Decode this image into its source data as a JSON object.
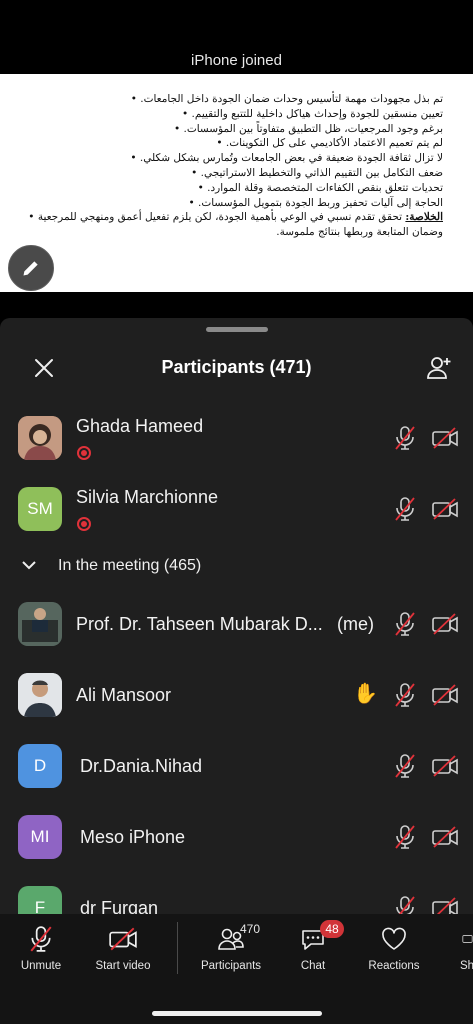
{
  "toast": "iPhone joined",
  "slide": {
    "lines": [
      "تم بذل مجهودات مهمة لتأسيس وحدات ضمان الجودة داخل الجامعات.",
      "تعيين منسقين للجودة وإحداث هياكل داخلية للتتبع والتقييم.",
      "برغم وجود المرجعيات، ظل التطبيق متفاوتاً بين المؤسسات.",
      "لم يتم تعميم الاعتماد الأكاديمي على كل التكوينات.",
      "لا تزال ثقافة الجودة ضعيفة في بعض الجامعات وتُمارس بشكل شكلي.",
      "ضعف التكامل بين التقييم الذاتي والتخطيط الاستراتيجي.",
      "تحديات تتعلق بنقص الكفاءات المتخصصة وقلة الموارد.",
      "الحاجة إلى آليات تحفيز وربط الجودة بتمويل المؤسسات."
    ],
    "conclusion_key": "الخلاصة:",
    "conclusion_line1": " تحقق تقدم نسبي في الوعي بأهمية الجودة، لكن يلزم تفعيل أعمق ومنهجي للمرجعية",
    "conclusion_line2": "وضمان المتابعة وربطها بنتائج ملموسة."
  },
  "panel": {
    "title": "Participants (471)",
    "section_label": "In the meeting (465)"
  },
  "participants": [
    {
      "name": "Ghada Hameed",
      "initials": "",
      "avatar_color": "#b98a72",
      "recording": true
    },
    {
      "name": "Silvia Marchionne",
      "initials": "SM",
      "avatar_color": "#8fbf5a",
      "recording": true
    },
    {
      "name": "Prof. Dr. Tahseen Mubarak D...",
      "me_label": "(me)",
      "initials": "",
      "avatar_color": "#3a4a46"
    },
    {
      "name": "Ali Mansoor",
      "initials": "",
      "avatar_color": "#d9dde2",
      "hand_raised": true
    },
    {
      "name": "Dr.Dania.Nihad",
      "initials": "D",
      "avatar_color": "#4f93e0"
    },
    {
      "name": "Meso iPhone",
      "initials": "MI",
      "avatar_color": "#8f64c4"
    },
    {
      "name": "dr Furqan",
      "initials": "F",
      "avatar_color": "#5aa86c"
    }
  ],
  "toolbar": {
    "unmute": "Unmute",
    "start_video": "Start video",
    "participants": "Participants",
    "participants_count": "470",
    "chat": "Chat",
    "chat_badge": "48",
    "reactions": "Reactions",
    "share": "Sh"
  },
  "colors": {
    "sheet_bg": "#1f1f1f",
    "muted_slash": "#e0323a",
    "toolbar_bg": "#141414"
  }
}
